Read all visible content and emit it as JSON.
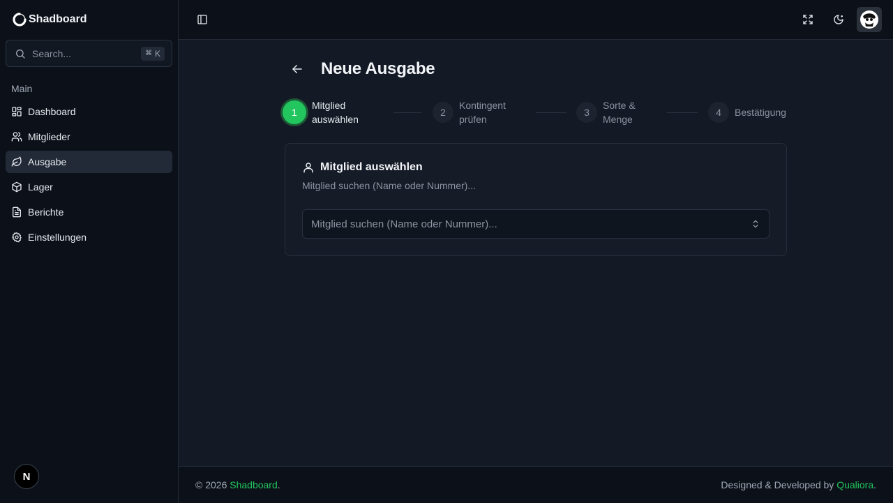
{
  "brand": {
    "name": "Shadboard"
  },
  "search": {
    "placeholder": "Search...",
    "shortcut_symbol": "⌘",
    "shortcut_key": "K"
  },
  "sidebar": {
    "group_label": "Main",
    "items": [
      {
        "label": "Dashboard",
        "icon": "dashboard-icon",
        "active": false
      },
      {
        "label": "Mitglieder",
        "icon": "users-icon",
        "active": false
      },
      {
        "label": "Ausgabe",
        "icon": "leaf-icon",
        "active": true
      },
      {
        "label": "Lager",
        "icon": "package-icon",
        "active": false
      },
      {
        "label": "Berichte",
        "icon": "file-text-icon",
        "active": false
      },
      {
        "label": "Einstellungen",
        "icon": "settings-icon",
        "active": false
      }
    ],
    "bottom_badge": "N"
  },
  "page": {
    "title": "Neue Ausgabe"
  },
  "stepper": {
    "steps": [
      {
        "num": "1",
        "label": "Mitglied auswählen",
        "active": true
      },
      {
        "num": "2",
        "label": "Kontingent prüfen",
        "active": false
      },
      {
        "num": "3",
        "label": "Sorte & Menge",
        "active": false
      },
      {
        "num": "4",
        "label": "Bestätigung",
        "active": false
      }
    ]
  },
  "card": {
    "title": "Mitglied auswählen",
    "description": "Mitglied suchen (Name oder Nummer)...",
    "select_placeholder": "Mitglied suchen (Name oder Nummer)..."
  },
  "footer": {
    "copyright_prefix": "© 2026 ",
    "brand_link": "Shadboard",
    "period": ".",
    "credit_prefix": "Designed & Developed by ",
    "credit_link": "Qualiora",
    "credit_period": "."
  },
  "colors": {
    "accent": "#22c55e",
    "sidebar_bg": "#0c1119",
    "main_bg": "#131a25",
    "card_bg": "#151c27",
    "active_item_bg": "#222a37"
  }
}
